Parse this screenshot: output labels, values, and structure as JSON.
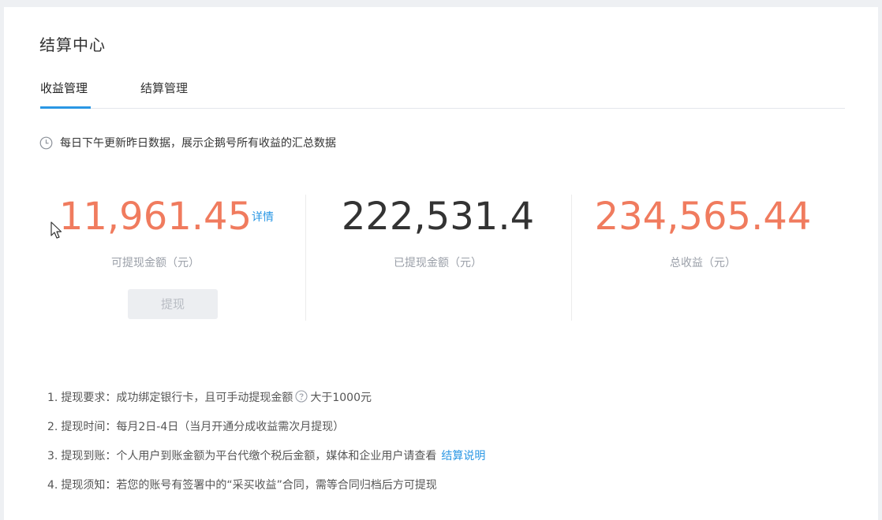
{
  "page": {
    "title": "结算中心"
  },
  "tabs": [
    {
      "label": "收益管理",
      "active": true
    },
    {
      "label": "结算管理",
      "active": false
    }
  ],
  "notice": {
    "icon": "clock-icon",
    "text": "每日下午更新昨日数据，展示企鹅号所有收益的汇总数据"
  },
  "stats": {
    "withdrawable": {
      "value": "11,961.45",
      "label": "可提现金额（元）",
      "detail_link": "详情",
      "color": "#f07b5e"
    },
    "withdrawn": {
      "value": "222,531.4",
      "label": "已提现金额（元）",
      "color": "#333333"
    },
    "total": {
      "value": "234,565.44",
      "label": "总收益（元）",
      "color": "#f07b5e"
    }
  },
  "withdraw_button": {
    "label": "提现",
    "disabled": true
  },
  "rules": {
    "r1": {
      "num": "1.",
      "title": "提现要求：",
      "text_before": "成功绑定银行卡，且可手动提现金额",
      "icon": "question-icon",
      "text_after": "大于1000元"
    },
    "r2": {
      "num": "2.",
      "title": "提现时间：",
      "text": "每月2日-4日（当月开通分成收益需次月提现）"
    },
    "r3": {
      "num": "3.",
      "title": "提现到账：",
      "text": "个人用户到账金额为平台代缴个税后金额，媒体和企业用户请查看",
      "link": "结算说明"
    },
    "r4": {
      "num": "4.",
      "title": "提现须知：",
      "text": "若您的账号有签署中的“采买收益”合同，需等合同归档后方可提现"
    }
  },
  "colors": {
    "accent": "#2a97e4",
    "highlight": "#f07b5e"
  }
}
